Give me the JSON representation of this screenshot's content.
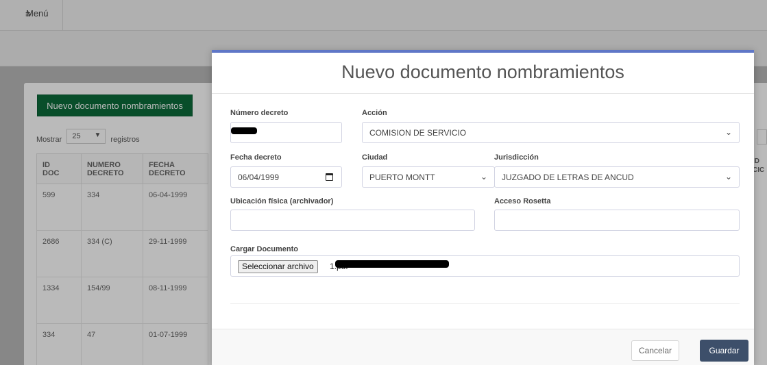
{
  "topbar": {
    "menu_label": "Menú"
  },
  "background": {
    "new_button": "Nuevo documento nombramientos",
    "show_prefix": "Mostrar",
    "show_value": "25",
    "show_suffix": "registros",
    "columns": [
      {
        "line1": "ID",
        "line2": "DOC"
      },
      {
        "line1": "NUMERO",
        "line2": "DECRETO"
      },
      {
        "line1": "FECHA",
        "line2": "DECRETO"
      }
    ],
    "rows": [
      [
        "599",
        "334",
        "06-04-1999"
      ],
      [
        "2686",
        "334 (C)",
        "29-11-1999"
      ],
      [
        "1334",
        "154/99",
        "08-11-1999"
      ],
      [
        "334",
        "47",
        "01-07-1999"
      ]
    ],
    "right_snip": [
      "ID",
      "CIC"
    ]
  },
  "modal": {
    "title": "Nuevo documento nombramientos",
    "numero_decreto": {
      "label": "Número decreto",
      "value": ""
    },
    "accion": {
      "label": "Acción",
      "value": "COMISION DE SERVICIO"
    },
    "fecha_decreto": {
      "label": "Fecha decreto",
      "value": "06/04/1999"
    },
    "ciudad": {
      "label": "Ciudad",
      "value": "PUERTO MONTT"
    },
    "jurisdiccion": {
      "label": "Jurisdicción",
      "value": "JUZGADO DE LETRAS DE ANCUD"
    },
    "ubicacion": {
      "label": "Ubicación física (archivador)",
      "value": ""
    },
    "acceso": {
      "label": "Acceso Rosetta",
      "value": ""
    },
    "cargar": {
      "label": "Cargar Documento",
      "button": "Seleccionar archivo",
      "file_name": "1.pdf"
    },
    "cancel_label": "Cancelar",
    "save_label": "Guardar"
  },
  "colors": {
    "accent_top": "#5f77c7",
    "save": "#3d4f6a",
    "new_button": "#0b6b3a"
  }
}
